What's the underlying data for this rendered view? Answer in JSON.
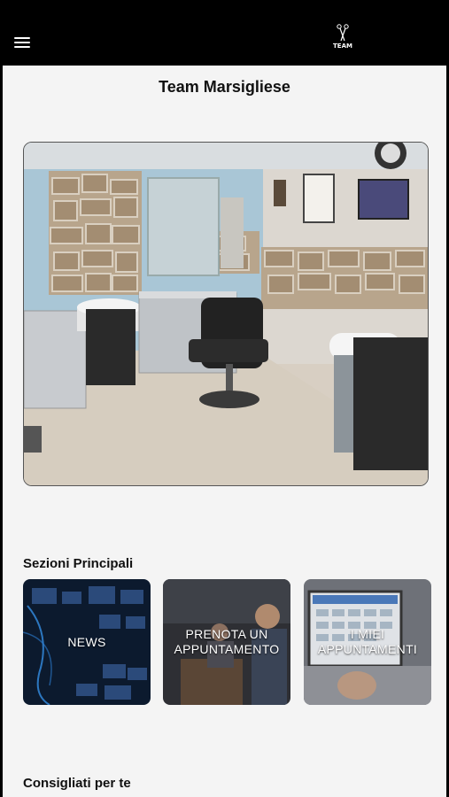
{
  "header": {
    "menu_icon": "hamburger-menu-icon",
    "logo_text": "TEAM",
    "colors": {
      "bar": "#000000",
      "icon": "#ffffff"
    }
  },
  "main": {
    "title": "Team Marsigliese",
    "hero_image": "barber-shop-interior-photo"
  },
  "sections": {
    "main_sections_title": "Sezioni Principali",
    "recommended_title": "Consigliati per te"
  },
  "cards": [
    {
      "label": "NEWS",
      "image": "news-screens-photo"
    },
    {
      "label": "PRENOTA UN APPUNTAMENTO",
      "image": "booking-desk-photo"
    },
    {
      "label": "I MIEI APPUNTAMENTI",
      "image": "calendar-laptop-photo"
    }
  ],
  "colors": {
    "background": "#f4f4f4",
    "text": "#111111"
  }
}
